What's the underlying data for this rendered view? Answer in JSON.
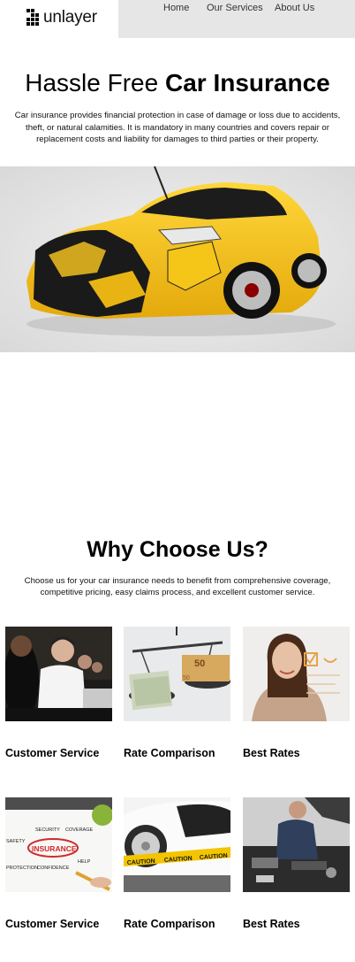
{
  "brand": {
    "name": "unlayer",
    "logo_icon": "pixel-grid-icon"
  },
  "nav": {
    "items": [
      "Home",
      "Our Services",
      "About Us"
    ]
  },
  "hero": {
    "title_light": "Hassle Free ",
    "title_bold": "Car Insurance",
    "text": "Car insurance provides financial protection in case of damage or loss due to accidents, theft, or natural calamities. It is mandatory in many countries and covers repair or replacement costs and liability for damages to third parties or their property.",
    "image": "damaged-yellow-car-image"
  },
  "why": {
    "title": "Why Choose Us?",
    "text": "Choose us for your car insurance needs to benefit from comprehensive coverage, competitive pricing, easy claims process, and excellent customer service."
  },
  "cards": [
    {
      "label": "Customer Service",
      "image": "call-center-image"
    },
    {
      "label": "Rate Comparison",
      "image": "money-scale-image"
    },
    {
      "label": "Best Rates",
      "image": "smiling-agent-image"
    },
    {
      "label": "Customer Service",
      "image": "insurance-diagram-image"
    },
    {
      "label": "Rate Comparison",
      "image": "caution-tape-car-image"
    },
    {
      "label": "Best Rates",
      "image": "mechanic-engine-image"
    }
  ],
  "diagram_words": [
    "SECURITY",
    "COVERAGE",
    "SAFETY",
    "INSURANCE",
    "HELP",
    "PROTECTION",
    "CONFIDENCE"
  ],
  "caution_text": "CAUTION",
  "banknote_value": "50",
  "colors": {
    "nav_bg": "#e6e6e6",
    "car_yellow": "#f5c518",
    "hero_bg": "#e4e4e4"
  }
}
